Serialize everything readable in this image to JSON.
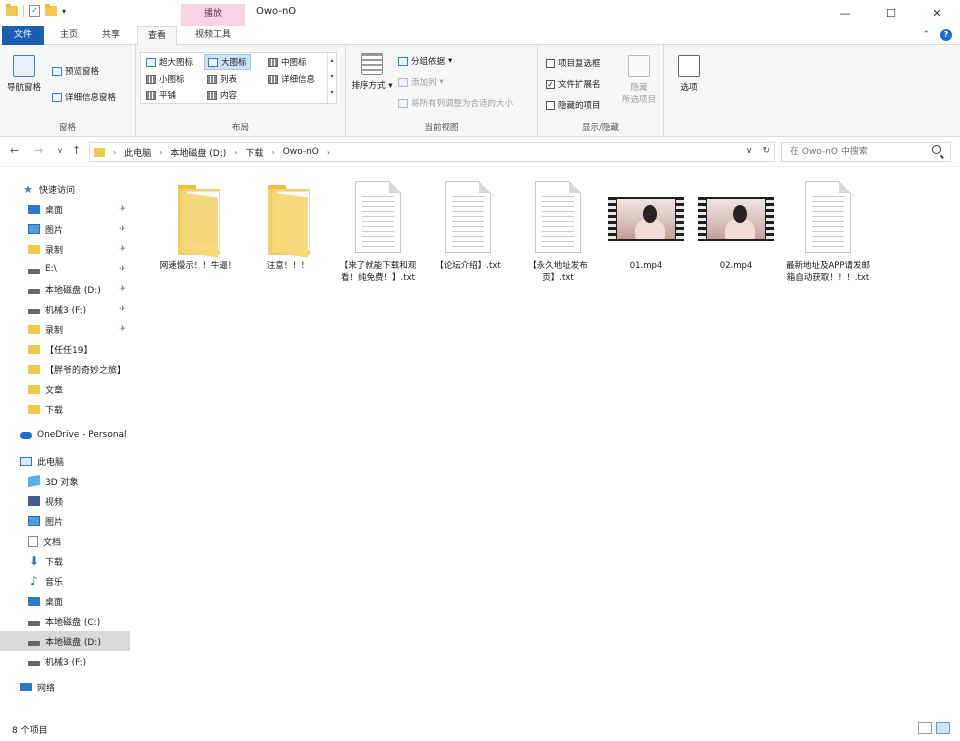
{
  "window": {
    "title": "Owo-nO",
    "context_tab_header": "播放",
    "controls": {
      "minimize": "—",
      "maximize": "☐",
      "close": "✕"
    }
  },
  "ribbon": {
    "tabs": [
      "文件",
      "主页",
      "共享",
      "查看",
      "视频工具"
    ],
    "active_tab": "查看",
    "groups": {
      "panes": {
        "label": "窗格",
        "nav_pane": "导航窗格",
        "preview_pane": "预览窗格",
        "details_pane": "详细信息窗格"
      },
      "layout": {
        "label": "布局",
        "items": [
          "超大图标",
          "大图标",
          "中图标",
          "小图标",
          "列表",
          "详细信息",
          "平铺",
          "内容"
        ],
        "selected": "大图标"
      },
      "current_view": {
        "label": "当前视图",
        "sort_by": "排序方式",
        "group_by": "分组依据",
        "add_columns": "添加列",
        "fit_columns": "将所有列调整为合适的大小"
      },
      "show_hide": {
        "label": "显示/隐藏",
        "item_checkboxes": "项目复选框",
        "file_extensions": "文件扩展名",
        "hidden_items": "隐藏的项目",
        "hide_selected": "隐藏",
        "hide_selected_2": "所选项目"
      },
      "options": {
        "label": "选项"
      }
    }
  },
  "addressbar": {
    "crumbs": [
      "此电脑",
      "本地磁盘 (D:)",
      "下载",
      "Owo-nO"
    ],
    "search_placeholder": "在 Owo-nO 中搜索"
  },
  "navpane": {
    "quick_access": "快速访问",
    "quick_items": [
      {
        "label": "桌面",
        "icon": "desktop-icon"
      },
      {
        "label": "图片",
        "icon": "pictures-icon"
      },
      {
        "label": "录制",
        "icon": "folder-icon"
      },
      {
        "label": "E:\\",
        "icon": "drive-icon"
      },
      {
        "label": "本地磁盘 (D:)",
        "icon": "drive-icon"
      },
      {
        "label": "机械3 (F:)",
        "icon": "drive-icon"
      },
      {
        "label": "录制",
        "icon": "folder-icon"
      },
      {
        "label": "【任任19】",
        "icon": "folder-icon"
      },
      {
        "label": "【胖爷的奇妙之旅】",
        "icon": "folder-icon"
      },
      {
        "label": "文章",
        "icon": "folder-icon"
      },
      {
        "label": "下载",
        "icon": "folder-icon"
      }
    ],
    "onedrive": "OneDrive - Personal",
    "this_pc": "此电脑",
    "pc_items": [
      {
        "label": "3D 对象",
        "icon": "3d-objects-icon"
      },
      {
        "label": "视频",
        "icon": "videos-icon"
      },
      {
        "label": "图片",
        "icon": "pictures-icon"
      },
      {
        "label": "文档",
        "icon": "documents-icon"
      },
      {
        "label": "下载",
        "icon": "downloads-icon"
      },
      {
        "label": "音乐",
        "icon": "music-icon"
      },
      {
        "label": "桌面",
        "icon": "desktop-icon"
      },
      {
        "label": "本地磁盘 (C:)",
        "icon": "drive-icon"
      },
      {
        "label": "本地磁盘 (D:)",
        "icon": "drive-icon"
      },
      {
        "label": "机械3 (F:)",
        "icon": "drive-icon"
      }
    ],
    "network": "网络"
  },
  "files": [
    {
      "name": "网速慢示！！牛逼！",
      "type": "folder-pictures"
    },
    {
      "name": "注意！！！",
      "type": "folder"
    },
    {
      "name": "【来了就能下载和观看！纯免费！】.txt",
      "type": "txt"
    },
    {
      "name": "【论坛介绍】.txt",
      "type": "txt"
    },
    {
      "name": "【永久地址发布页】.txt",
      "type": "txt"
    },
    {
      "name": "01.mp4",
      "type": "video"
    },
    {
      "name": "02.mp4",
      "type": "video"
    },
    {
      "name": "最新地址及APP请发邮箱自动获取！！！.txt",
      "type": "txt"
    }
  ],
  "statusbar": {
    "item_count": "8 个项目"
  }
}
